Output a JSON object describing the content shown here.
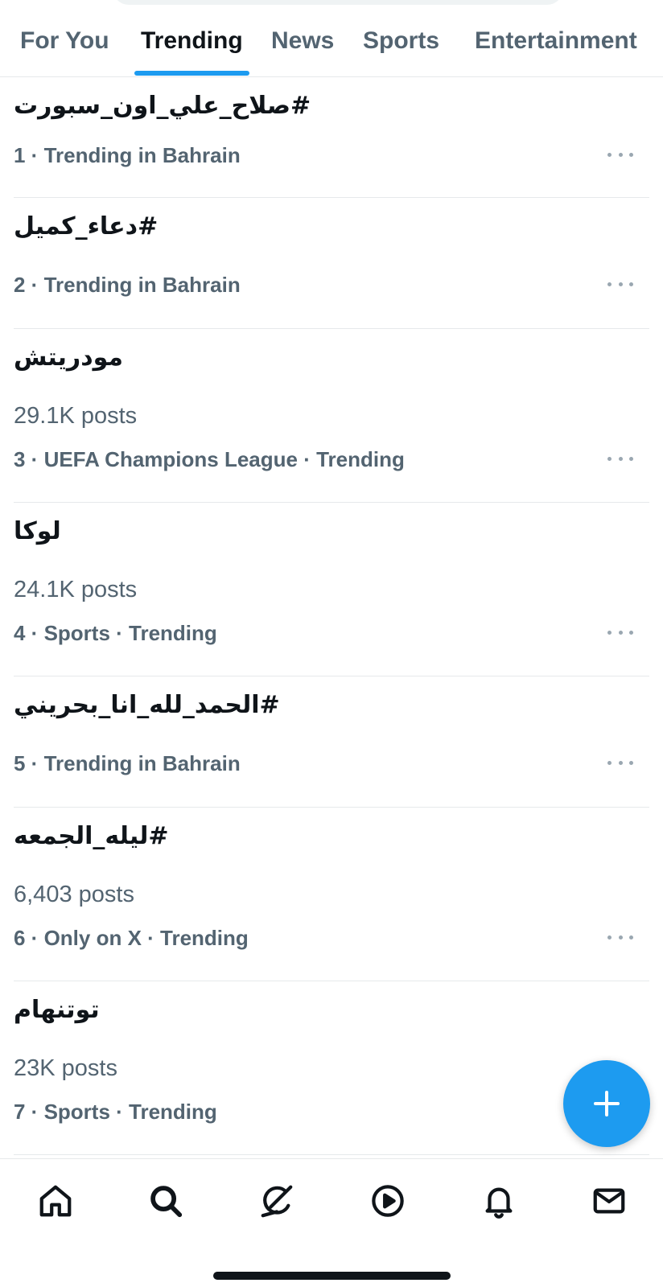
{
  "tabs": [
    {
      "label": "For You"
    },
    {
      "label": "Trending"
    },
    {
      "label": "News"
    },
    {
      "label": "Sports"
    },
    {
      "label": "Entertainment"
    }
  ],
  "active_tab": "Trending",
  "trends": [
    {
      "title": "#صلاح_علي_اون_سبورت",
      "posts": "",
      "context": "1 · Trending in Bahrain"
    },
    {
      "title": "#دعاء_كميل",
      "posts": "",
      "context": "2 · Trending in Bahrain"
    },
    {
      "title": "مودريتش",
      "posts": "29.1K posts",
      "context": "3 · UEFA Champions League · Trending"
    },
    {
      "title": "لوكا",
      "posts": "24.1K posts",
      "context": "4 · Sports · Trending"
    },
    {
      "title": "#الحمد_لله_انا_بحريني",
      "posts": "",
      "context": "5 · Trending in Bahrain"
    },
    {
      "title": "#ليله_الجمعه",
      "posts": "6,403 posts",
      "context": "6 · Only on X · Trending"
    },
    {
      "title": "توتنهام",
      "posts": "23K posts",
      "context": "7 · Sports · Trending"
    }
  ],
  "bottom_nav": [
    {
      "icon": "home-icon"
    },
    {
      "icon": "search-icon"
    },
    {
      "icon": "grok-icon"
    },
    {
      "icon": "play-icon"
    },
    {
      "icon": "bell-icon"
    },
    {
      "icon": "mail-icon"
    }
  ],
  "colors": {
    "accent": "#1d9bf0",
    "text_primary": "#0f1419",
    "text_secondary": "#536471",
    "divider": "#e6e9eb"
  }
}
